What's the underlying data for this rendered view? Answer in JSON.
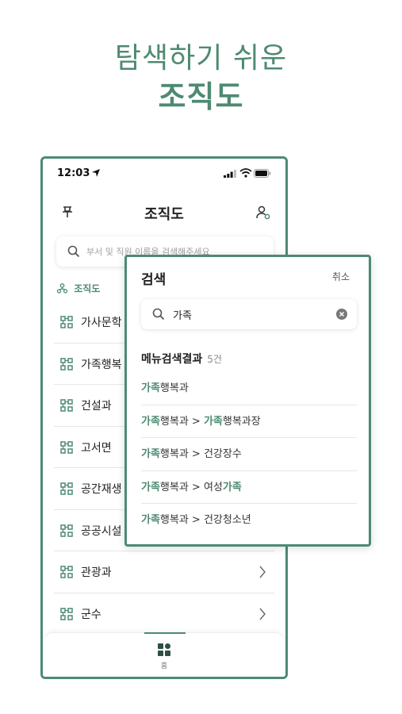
{
  "hero": {
    "line1": "탐색하기 쉬운",
    "line2": "조직도"
  },
  "status": {
    "time": "12:03"
  },
  "appbar": {
    "title": "조직도",
    "pin_icon": "pin-icon",
    "user_settings_icon": "user-settings-icon"
  },
  "search": {
    "placeholder": "부서 및 직원 이름을 검색해주세요"
  },
  "section": {
    "label": "조직도"
  },
  "org_list": [
    {
      "label": "가사문학"
    },
    {
      "label": "가족행복"
    },
    {
      "label": "건설과"
    },
    {
      "label": "고서면"
    },
    {
      "label": "공간재생"
    },
    {
      "label": "공공시설"
    },
    {
      "label": "관광과"
    },
    {
      "label": "군수"
    }
  ],
  "tabbar": {
    "home_label": "홈"
  },
  "popup": {
    "title": "검색",
    "cancel_label": "취소",
    "query": "가족",
    "results_header": "메뉴검색결과",
    "results_count": "5건",
    "results": [
      {
        "parts": [
          {
            "text": "가족",
            "hl": true
          },
          {
            "text": "행복과",
            "hl": false
          }
        ]
      },
      {
        "parts": [
          {
            "text": "가족",
            "hl": true
          },
          {
            "text": "행복과 > ",
            "hl": false
          },
          {
            "text": "가족",
            "hl": true
          },
          {
            "text": "행복과장",
            "hl": false
          }
        ]
      },
      {
        "parts": [
          {
            "text": "가족",
            "hl": true
          },
          {
            "text": "행복과 > 건강장수",
            "hl": false
          }
        ]
      },
      {
        "parts": [
          {
            "text": "가족",
            "hl": true
          },
          {
            "text": "행복과 > 여성",
            "hl": false
          },
          {
            "text": "가족",
            "hl": true
          }
        ]
      },
      {
        "parts": [
          {
            "text": "가족",
            "hl": true
          },
          {
            "text": "행복과 > 건강청소년",
            "hl": false
          }
        ]
      }
    ]
  },
  "colors": {
    "accent": "#4e8a72"
  }
}
